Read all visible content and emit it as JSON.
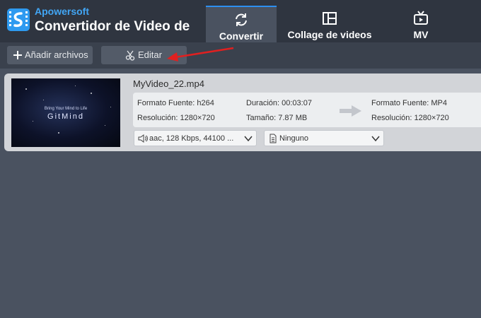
{
  "app": {
    "brand": "Apowersoft",
    "title": "Convertidor de Video de"
  },
  "tabs": [
    {
      "label": "Convertir",
      "icon": "refresh-icon",
      "active": true
    },
    {
      "label": "Collage de videos",
      "icon": "collage-icon",
      "active": false
    },
    {
      "label": "MV",
      "icon": "tv-icon",
      "active": false
    }
  ],
  "toolbar": {
    "add_label": "Añadir archivos",
    "edit_label": "Editar"
  },
  "file": {
    "name": "MyVideo_22.mp4",
    "thumbnail": {
      "tagline": "Bring Your Mind to Life",
      "logo_text": "GitMind"
    },
    "source": {
      "format": "Formato Fuente: h264",
      "resolution": "Resolución: 1280×720",
      "duration": "Duración: 00:03:07",
      "size": "Tamaño: 7.87 MB"
    },
    "target": {
      "format": "Formato Fuente: MP4",
      "resolution": "Resolución: 1280×720"
    },
    "audio_track": "aac, 128 Kbps, 44100 ...",
    "subtitle": "Ninguno"
  },
  "colors": {
    "titlebar": "#2f3540",
    "toolbar": "#3a414d",
    "background": "#4a5260",
    "accent": "#2d8ff0",
    "brand": "#42a6f5",
    "annotation_arrow": "#e02020"
  }
}
